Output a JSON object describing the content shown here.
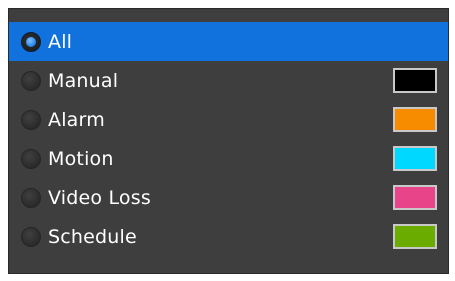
{
  "filter_list": {
    "items": [
      {
        "label": "All",
        "selected": true,
        "color": null
      },
      {
        "label": "Manual",
        "selected": false,
        "color": "#000000"
      },
      {
        "label": "Alarm",
        "selected": false,
        "color": "#f78c00"
      },
      {
        "label": "Motion",
        "selected": false,
        "color": "#00d8ff"
      },
      {
        "label": "Video Loss",
        "selected": false,
        "color": "#e8448a"
      },
      {
        "label": "Schedule",
        "selected": false,
        "color": "#6bac00"
      }
    ]
  },
  "colors": {
    "panel_background": "#3e3e3e",
    "selection": "#1272dd",
    "text": "#ffffff",
    "swatch_border": "#c8c8c8"
  }
}
